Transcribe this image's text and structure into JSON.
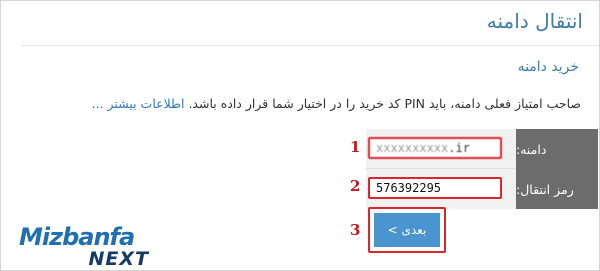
{
  "header": {
    "title": "انتقال دامنه",
    "subtitle": "خرید دامنه"
  },
  "description": {
    "text": "صاحب امتیاز فعلی دامنه، باید PIN کد خرید را در اختیار شما قرار داده باشد.",
    "link": "اطلاعات بیشتر ..."
  },
  "form": {
    "domain_label": "دامنه:",
    "domain_value_tld": ".ir",
    "password_label": "رمز انتقال:",
    "password_value": "576392295",
    "next_button": "بعدی >"
  },
  "annotations": [
    "1",
    "2",
    "3"
  ],
  "logo": {
    "top": "Mizbanfa",
    "bottom": "NEXT"
  },
  "colors": {
    "accent": "#3d7ea6",
    "highlight": "#d9262c",
    "button": "#4a94cf",
    "label_bg": "#6c6c6c"
  }
}
